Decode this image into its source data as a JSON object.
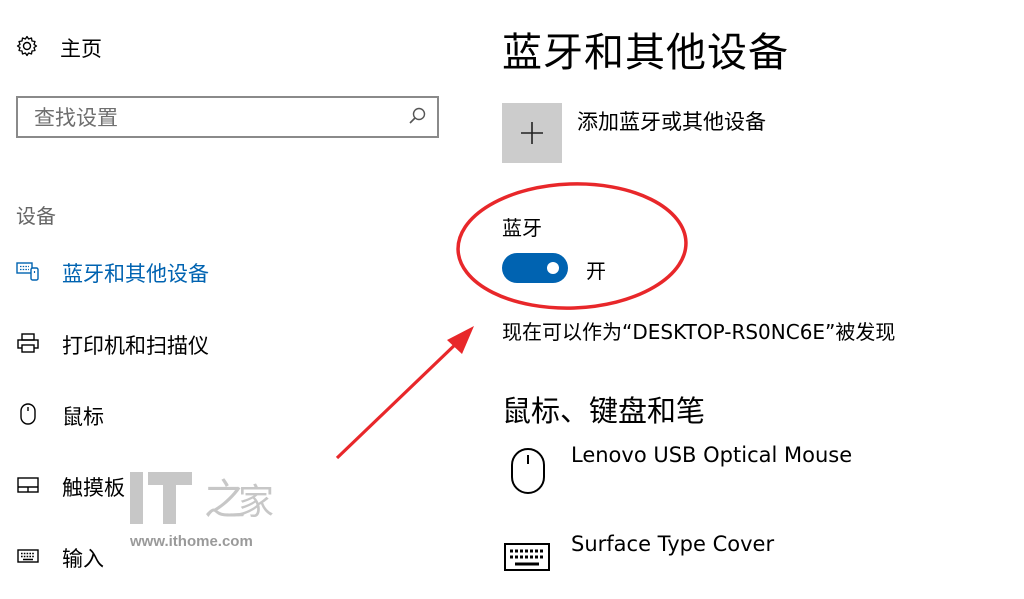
{
  "sidebar": {
    "home_label": "主页",
    "search": {
      "placeholder": "查找设置"
    },
    "section_title": "设备",
    "items": [
      {
        "label": "蓝牙和其他设备",
        "icon": "bluetooth-devices-icon",
        "active": true
      },
      {
        "label": "打印机和扫描仪",
        "icon": "printer-icon",
        "active": false
      },
      {
        "label": "鼠标",
        "icon": "mouse-icon",
        "active": false
      },
      {
        "label": "触摸板",
        "icon": "touchpad-icon",
        "active": false
      },
      {
        "label": "输入",
        "icon": "keyboard-icon",
        "active": false
      }
    ]
  },
  "main": {
    "title": "蓝牙和其他设备",
    "add_device_label": "添加蓝牙或其他设备",
    "bluetooth": {
      "label": "蓝牙",
      "state_label": "开",
      "enabled": true,
      "discoverable_text": "现在可以作为“DESKTOP-RS0NC6E”被发现"
    },
    "mouse_section": {
      "title": "鼠标、键盘和笔",
      "devices": [
        {
          "name": "Lenovo USB Optical Mouse",
          "icon": "mouse-icon"
        },
        {
          "name": "Surface Type Cover",
          "icon": "keyboard-icon"
        }
      ]
    }
  },
  "watermark": {
    "url": "www.ithome.com"
  },
  "colors": {
    "accent": "#0063b1",
    "annotation": "#e8272a",
    "tile": "#cccccc"
  }
}
